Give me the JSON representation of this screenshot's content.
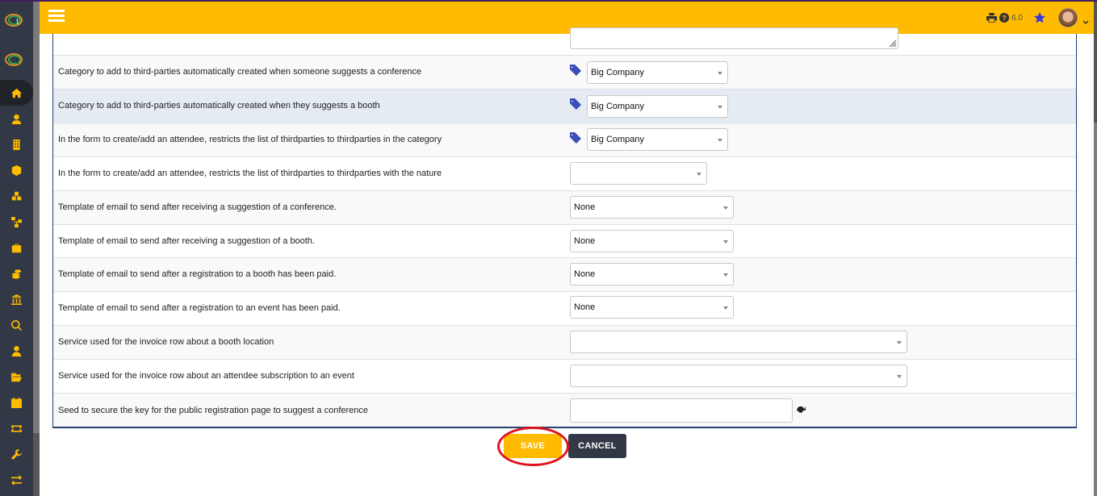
{
  "header": {
    "menu_icon": "hamburger-menu-icon",
    "print_icon": "print-icon",
    "help_icon": "help-icon",
    "version": "6.0",
    "bookmark_icon": "star-icon",
    "user_menu_icon": "chevron-down-icon"
  },
  "sidebar": {
    "items": [
      {
        "name": "home",
        "icon": "home-icon",
        "active": true
      },
      {
        "name": "users",
        "icon": "user-icon"
      },
      {
        "name": "companies",
        "icon": "building-icon"
      },
      {
        "name": "products",
        "icon": "box-icon"
      },
      {
        "name": "projects",
        "icon": "cubes-icon"
      },
      {
        "name": "network",
        "icon": "sitemap-icon"
      },
      {
        "name": "hrm",
        "icon": "briefcase-icon"
      },
      {
        "name": "billing",
        "icon": "coins-icon"
      },
      {
        "name": "bank",
        "icon": "bank-icon"
      },
      {
        "name": "search-money",
        "icon": "search-dollar-icon"
      },
      {
        "name": "members",
        "icon": "user-tie-icon"
      },
      {
        "name": "documents",
        "icon": "folder-open-icon"
      },
      {
        "name": "agenda",
        "icon": "calendar-icon"
      },
      {
        "name": "tickets",
        "icon": "ticket-icon"
      },
      {
        "name": "tools",
        "icon": "wrench-icon"
      },
      {
        "name": "transfers",
        "icon": "exchange-icon"
      }
    ]
  },
  "form": {
    "rows": [
      {
        "label": "Category to add to third-parties automatically created when someone suggests a conference",
        "type": "category-select",
        "value": "Big Company"
      },
      {
        "label": "Category to add to third-parties automatically created when they suggests a booth",
        "type": "category-select",
        "value": "Big Company"
      },
      {
        "label": "In the form to create/add an attendee, restricts the list of thirdparties to thirdparties in the category",
        "type": "category-select",
        "value": "Big Company"
      },
      {
        "label": "In the form to create/add an attendee, restricts the list of thirdparties to thirdparties with the nature",
        "type": "select",
        "value": ""
      },
      {
        "label": "Template of email to send after receiving a suggestion of a conference.",
        "type": "select",
        "value": "None"
      },
      {
        "label": "Template of email to send after receiving a suggestion of a booth.",
        "type": "select",
        "value": "None"
      },
      {
        "label": "Template of email to send after a registration to a booth has been paid.",
        "type": "select",
        "value": "None"
      },
      {
        "label": "Template of email to send after a registration to an event has been paid.",
        "type": "select",
        "value": "None"
      },
      {
        "label": "Service used for the invoice row about a booth location",
        "type": "wide-select",
        "value": ""
      },
      {
        "label": "Service used for the invoice row about an attendee subscription to an event",
        "type": "wide-select",
        "value": ""
      },
      {
        "label": "Seed to secure the key for the public registration page to suggest a conference",
        "type": "text",
        "value": ""
      }
    ]
  },
  "actions": {
    "save_label": "SAVE",
    "cancel_label": "CANCEL"
  },
  "colors": {
    "accent": "#ffbb00",
    "sidebar": "#323845",
    "tag": "#3b4db8",
    "highlight_row": "#e5ebf3",
    "annotation": "#e0141e"
  }
}
